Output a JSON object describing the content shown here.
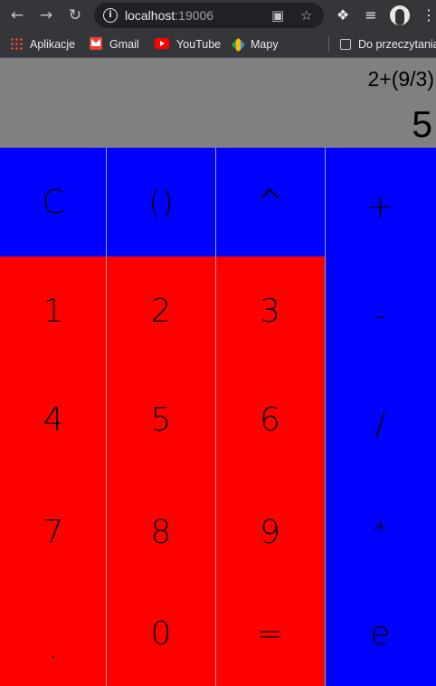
{
  "browser": {
    "url_host": "localhost",
    "url_port": ":19006",
    "icons": [
      "back-icon",
      "forward-icon",
      "reload-icon",
      "info-icon",
      "translate-icon",
      "star-icon",
      "extensions-icon",
      "media-icon",
      "avatar",
      "menu-icon"
    ],
    "bookmarks": [
      {
        "label": "Aplikacje",
        "icon": "apps-icon"
      },
      {
        "label": "Gmail",
        "icon": "gmail-icon"
      },
      {
        "label": "YouTube",
        "icon": "youtube-icon"
      },
      {
        "label": "Mapy",
        "icon": "maps-icon"
      }
    ],
    "reading_list": "Do przeczytania"
  },
  "calculator": {
    "expression": "2+(9/3)",
    "result": "5",
    "colors": {
      "display": "#808080",
      "operator_key": "#0000ff",
      "digit_key": "#ff0000"
    },
    "keys": {
      "clear": "C",
      "parens": "()",
      "power": "^",
      "plus": "+",
      "one": "1",
      "two": "2",
      "three": "3",
      "minus": "-",
      "four": "4",
      "five": "5",
      "six": "6",
      "divide": "/",
      "seven": "7",
      "eight": "8",
      "nine": "9",
      "multiply": "*",
      "dot": ".",
      "zero": "0",
      "equals": "=",
      "e": "e"
    }
  }
}
